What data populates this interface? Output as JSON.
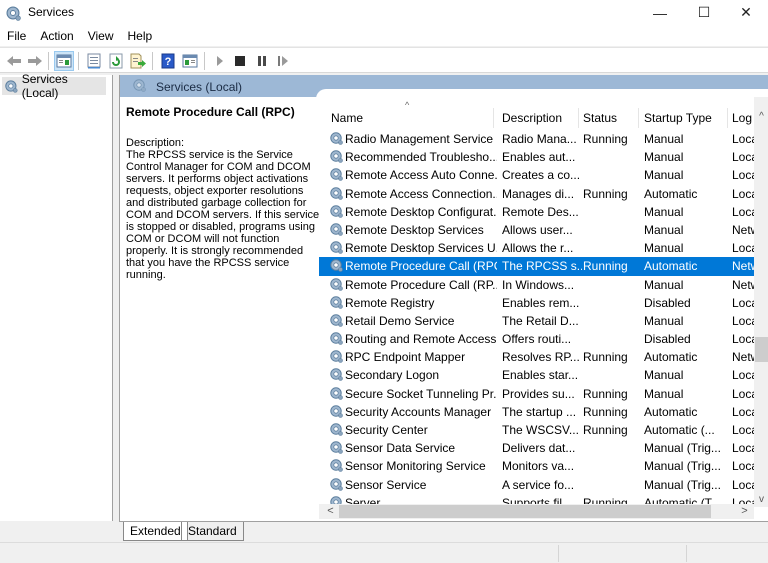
{
  "window": {
    "title": "Services",
    "icon": "services-gear-icon",
    "controls": {
      "minimize": "—",
      "maximize": "☐",
      "close": "✕"
    }
  },
  "menubar": [
    "File",
    "Action",
    "View",
    "Help"
  ],
  "toolbar": {
    "buttons": [
      "back-arrow-icon",
      "forward-arrow-icon",
      "show-hide-console-tree-icon",
      "properties-icon",
      "refresh-icon",
      "export-list-icon",
      "help-icon",
      "show-action-pane-icon",
      "start-service-icon",
      "stop-service-icon",
      "pause-service-icon",
      "resume-service-icon"
    ]
  },
  "tree": {
    "root": "Services (Local)"
  },
  "main": {
    "header": "Services (Local)",
    "selected_service": {
      "name": "Remote Procedure Call (RPC)",
      "description_label": "Description:",
      "description": "The RPCSS service is the Service Control Manager for COM and DCOM servers. It performs object activations requests, object exporter resolutions and distributed garbage collection for COM and DCOM servers. If this service is stopped or disabled, programs using COM or DCOM will not function properly. It is strongly recommended that you have the RPCSS service running."
    },
    "columns": [
      "Name",
      "Description",
      "Status",
      "Startup Type",
      "Log"
    ],
    "sort_indicator": "^",
    "rows": [
      {
        "name": "Radio Management Service",
        "description": "Radio Mana...",
        "status": "Running",
        "startup": "Manual",
        "log": "Loca"
      },
      {
        "name": "Recommended Troublesho...",
        "description": "Enables aut...",
        "status": "",
        "startup": "Manual",
        "log": "Loca"
      },
      {
        "name": "Remote Access Auto Conne...",
        "description": "Creates a co...",
        "status": "",
        "startup": "Manual",
        "log": "Loca"
      },
      {
        "name": "Remote Access Connection...",
        "description": "Manages di...",
        "status": "Running",
        "startup": "Automatic",
        "log": "Loca"
      },
      {
        "name": "Remote Desktop Configurat...",
        "description": "Remote Des...",
        "status": "",
        "startup": "Manual",
        "log": "Loca"
      },
      {
        "name": "Remote Desktop Services",
        "description": "Allows user...",
        "status": "",
        "startup": "Manual",
        "log": "Netw"
      },
      {
        "name": "Remote Desktop Services U...",
        "description": "Allows the r...",
        "status": "",
        "startup": "Manual",
        "log": "Loca"
      },
      {
        "name": "Remote Procedure Call (RPC)",
        "description": "The RPCSS s...",
        "status": "Running",
        "startup": "Automatic",
        "log": "Netw",
        "selected": true
      },
      {
        "name": "Remote Procedure Call (RP...",
        "description": "In Windows...",
        "status": "",
        "startup": "Manual",
        "log": "Netw"
      },
      {
        "name": "Remote Registry",
        "description": "Enables rem...",
        "status": "",
        "startup": "Disabled",
        "log": "Loca"
      },
      {
        "name": "Retail Demo Service",
        "description": "The Retail D...",
        "status": "",
        "startup": "Manual",
        "log": "Loca"
      },
      {
        "name": "Routing and Remote Access",
        "description": "Offers routi...",
        "status": "",
        "startup": "Disabled",
        "log": "Loca"
      },
      {
        "name": "RPC Endpoint Mapper",
        "description": "Resolves RP...",
        "status": "Running",
        "startup": "Automatic",
        "log": "Netw"
      },
      {
        "name": "Secondary Logon",
        "description": "Enables star...",
        "status": "",
        "startup": "Manual",
        "log": "Loca"
      },
      {
        "name": "Secure Socket Tunneling Pr...",
        "description": "Provides su...",
        "status": "Running",
        "startup": "Manual",
        "log": "Loca"
      },
      {
        "name": "Security Accounts Manager",
        "description": "The startup ...",
        "status": "Running",
        "startup": "Automatic",
        "log": "Loca"
      },
      {
        "name": "Security Center",
        "description": "The WSCSV...",
        "status": "Running",
        "startup": "Automatic (...",
        "log": "Loca"
      },
      {
        "name": "Sensor Data Service",
        "description": "Delivers dat...",
        "status": "",
        "startup": "Manual (Trig...",
        "log": "Loca"
      },
      {
        "name": "Sensor Monitoring Service",
        "description": "Monitors va...",
        "status": "",
        "startup": "Manual (Trig...",
        "log": "Loca"
      },
      {
        "name": "Sensor Service",
        "description": "A service fo...",
        "status": "",
        "startup": "Manual (Trig...",
        "log": "Loca"
      },
      {
        "name": "Server",
        "description": "Supports fil...",
        "status": "Running",
        "startup": "Automatic (T...",
        "log": "Loca"
      }
    ]
  },
  "scrollbars": {
    "up": "^",
    "down": "v",
    "left": "<",
    "right": ">"
  },
  "tabs": [
    "Extended",
    "Standard"
  ],
  "colors": {
    "selection": "#0078d7",
    "header_band": "#9db8d6"
  }
}
